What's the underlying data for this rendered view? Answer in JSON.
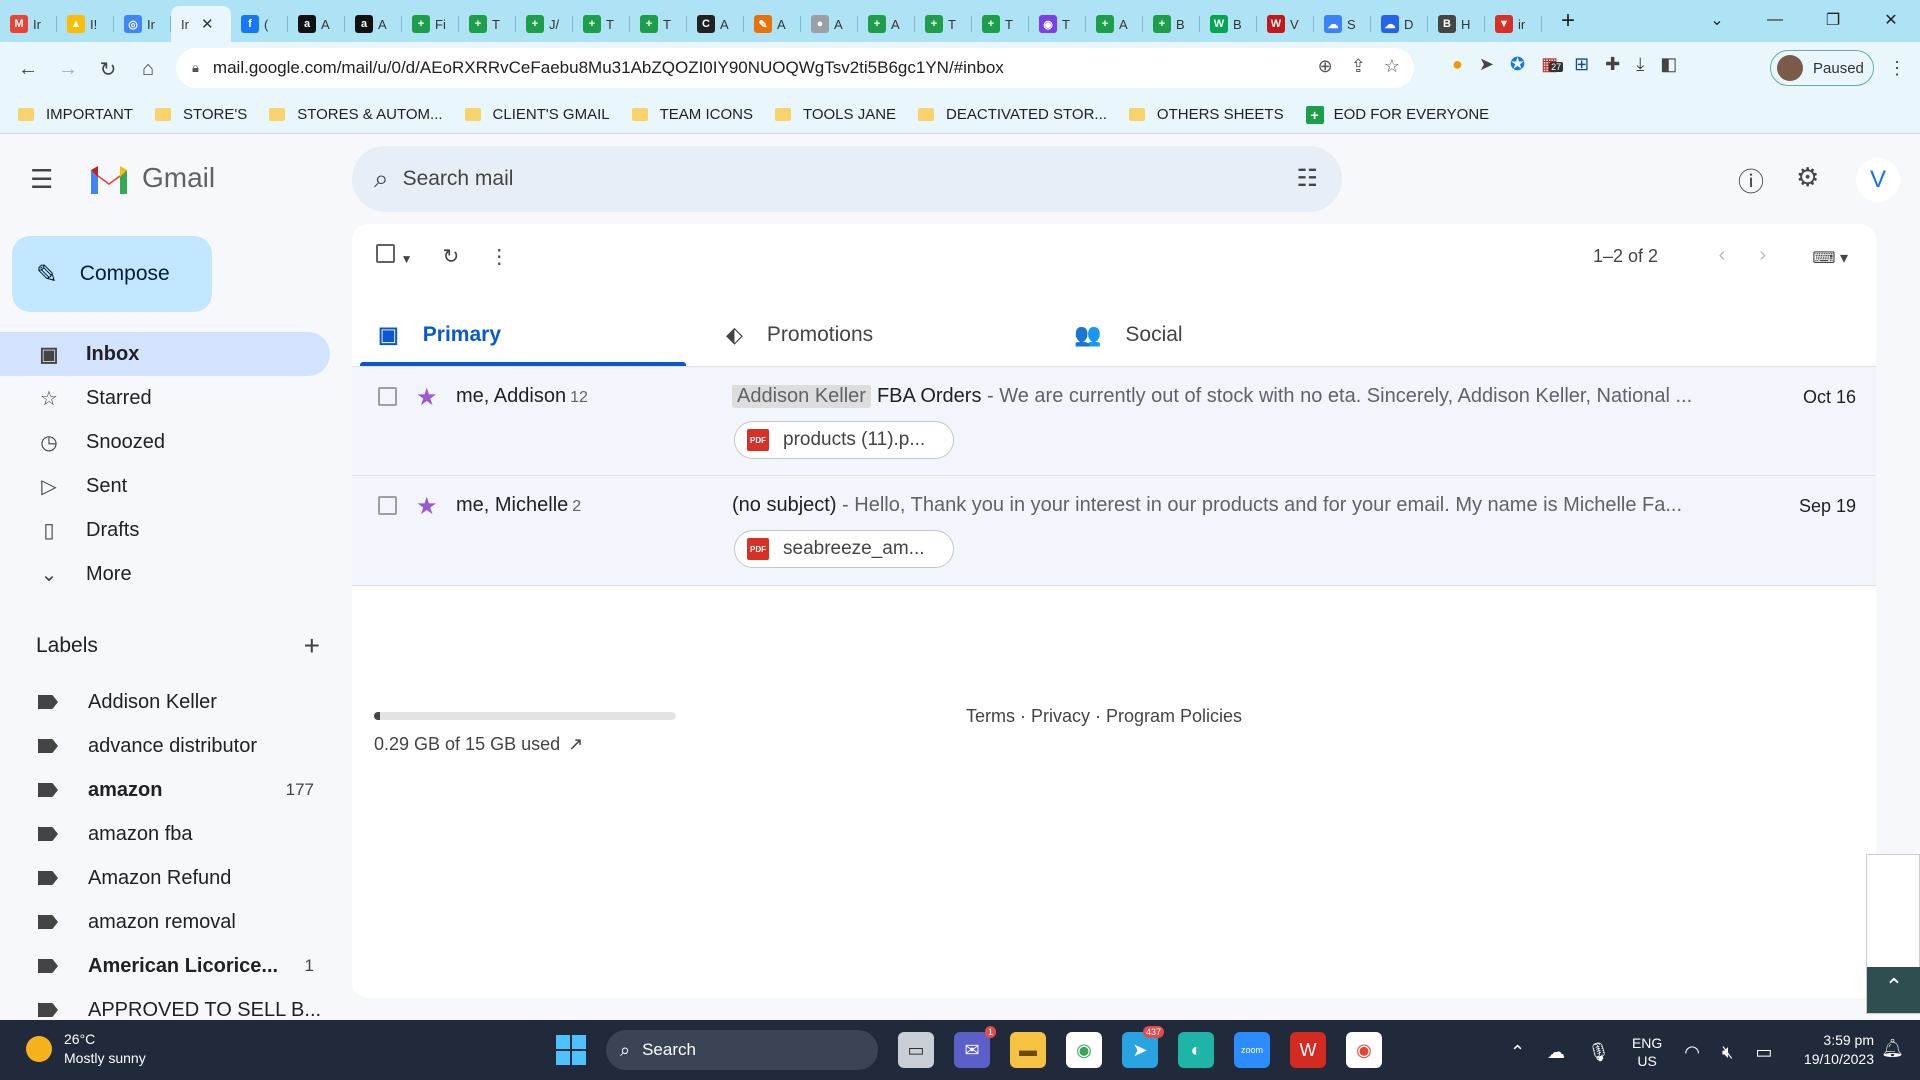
{
  "browser": {
    "tabs": [
      {
        "fav": "M",
        "color": "#ea4335",
        "label": "Ir"
      },
      {
        "fav": "▲",
        "color": "#fbbc04",
        "label": "I!"
      },
      {
        "fav": "◎",
        "color": "#4285f4",
        "label": "Ir"
      },
      {
        "fav": "",
        "color": "#aee3f5",
        "label": "Ir",
        "active": true
      },
      {
        "fav": "f",
        "color": "#1877f2",
        "label": "("
      },
      {
        "fav": "a",
        "color": "#111111",
        "label": "A"
      },
      {
        "fav": "a",
        "color": "#111111",
        "label": "A"
      },
      {
        "fav": "+",
        "color": "#1e9e4a",
        "label": "Fi"
      },
      {
        "fav": "+",
        "color": "#1e9e4a",
        "label": "T"
      },
      {
        "fav": "+",
        "color": "#1e9e4a",
        "label": "J/"
      },
      {
        "fav": "+",
        "color": "#1e9e4a",
        "label": "T"
      },
      {
        "fav": "+",
        "color": "#1e9e4a",
        "label": "T"
      },
      {
        "fav": "C",
        "color": "#222222",
        "label": "A"
      },
      {
        "fav": "✎",
        "color": "#e8710a",
        "label": "A"
      },
      {
        "fav": "●",
        "color": "#9aa0a6",
        "label": "A"
      },
      {
        "fav": "+",
        "color": "#1e9e4a",
        "label": "A"
      },
      {
        "fav": "+",
        "color": "#1e9e4a",
        "label": "T"
      },
      {
        "fav": "+",
        "color": "#1e9e4a",
        "label": "T"
      },
      {
        "fav": "◉",
        "color": "#7b3fe4",
        "label": "T"
      },
      {
        "fav": "+",
        "color": "#1e9e4a",
        "label": "A"
      },
      {
        "fav": "+",
        "color": "#1e9e4a",
        "label": "B"
      },
      {
        "fav": "W",
        "color": "#00a650",
        "label": "B"
      },
      {
        "fav": "W",
        "color": "#c4161c",
        "label": "V"
      },
      {
        "fav": "☁",
        "color": "#3b82f6",
        "label": "S"
      },
      {
        "fav": "☁",
        "color": "#2563eb",
        "label": "D"
      },
      {
        "fav": "B",
        "color": "#444444",
        "label": "H"
      },
      {
        "fav": "▼",
        "color": "#d93025",
        "label": "ir"
      }
    ],
    "url": "mail.google.com/mail/u/0/d/AEoRXRRvCeFaebu8Mu31AbZQOZI0IY90NUOQWgTsv2ti5B6gc1YN/#inbox",
    "profile_status": "Paused",
    "extension_badge": "27",
    "bookmarks": [
      {
        "type": "folder",
        "label": "IMPORTANT"
      },
      {
        "type": "folder",
        "label": "STORE'S"
      },
      {
        "type": "folder",
        "label": "STORES & AUTOM..."
      },
      {
        "type": "folder",
        "label": "CLIENT'S GMAIL"
      },
      {
        "type": "folder",
        "label": "TEAM ICONS"
      },
      {
        "type": "folder",
        "label": "TOOLS JANE"
      },
      {
        "type": "folder",
        "label": "DEACTIVATED STOR..."
      },
      {
        "type": "folder",
        "label": "OTHERS SHEETS"
      },
      {
        "type": "sheet",
        "label": "EOD FOR EVERYONE"
      }
    ]
  },
  "gmail": {
    "logo_text": "Gmail",
    "search_placeholder": "Search mail",
    "avatar_letter": "V",
    "compose_label": "Compose",
    "nav": [
      {
        "icon": "inbox-icon",
        "glyph": "▣",
        "label": "Inbox",
        "active": true
      },
      {
        "icon": "star-icon",
        "glyph": "☆",
        "label": "Starred"
      },
      {
        "icon": "clock-icon",
        "glyph": "◷",
        "label": "Snoozed"
      },
      {
        "icon": "send-icon",
        "glyph": "▷",
        "label": "Sent"
      },
      {
        "icon": "draft-icon",
        "glyph": "▯",
        "label": "Drafts"
      },
      {
        "icon": "chevron-down-icon",
        "glyph": "⌄",
        "label": "More"
      }
    ],
    "labels_title": "Labels",
    "labels": [
      {
        "label": "Addison Keller",
        "bold": false,
        "count": ""
      },
      {
        "label": "advance distributor",
        "bold": false,
        "count": ""
      },
      {
        "label": "amazon",
        "bold": true,
        "count": "177"
      },
      {
        "label": "amazon fba",
        "bold": false,
        "count": ""
      },
      {
        "label": "Amazon Refund",
        "bold": false,
        "count": ""
      },
      {
        "label": "amazon removal",
        "bold": false,
        "count": ""
      },
      {
        "label": "American Licorice...",
        "bold": true,
        "count": "1"
      },
      {
        "label": "APPROVED TO SELL B...",
        "bold": false,
        "count": ""
      }
    ],
    "pager_text": "1–2 of 2",
    "tabs": [
      {
        "icon": "inbox-tab-icon",
        "glyph": "▣",
        "label": "Primary",
        "active": true
      },
      {
        "icon": "tag-icon",
        "glyph": "⬖",
        "label": "Promotions"
      },
      {
        "icon": "people-icon",
        "glyph": "👥",
        "label": "Social"
      }
    ],
    "emails": [
      {
        "sender": "me, Addison",
        "count": "12",
        "label_tag": "Addison Keller",
        "subject": "FBA Orders",
        "snippet": " - We are currently out of stock with no eta. Sincerely, Addison Keller, National ...",
        "date": "Oct 16",
        "attachment": "products (11).p..."
      },
      {
        "sender": "me, Michelle",
        "count": "2",
        "label_tag": "",
        "subject": "(no subject)",
        "snippet": " - Hello, Thank you in your interest in our products and for your email. My name is Michelle Fa...",
        "date": "Sep 19",
        "attachment": "seabreeze_am..."
      }
    ],
    "storage_text": "0.29 GB of 15 GB used",
    "storage_fraction": 0.019,
    "footer_links": "Terms · Privacy · Program Policies"
  },
  "taskbar": {
    "temperature": "26°C",
    "weather": "Mostly sunny",
    "search_label": "Search",
    "lang_top": "ENG",
    "lang_bottom": "US",
    "time": "3:59 pm",
    "date": "19/10/2023",
    "telegram_badge": "437",
    "teams_badge": "1"
  }
}
